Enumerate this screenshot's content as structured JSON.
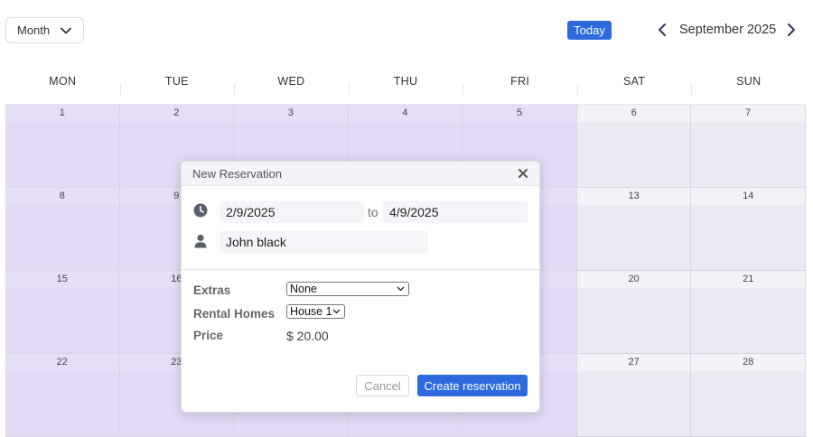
{
  "toolbar": {
    "view_label": "Month",
    "today_label": "Today",
    "month_label": "September 2025"
  },
  "calendar": {
    "days_of_week": [
      "MON",
      "TUE",
      "WED",
      "THU",
      "FRI",
      "SAT",
      "SUN"
    ],
    "weeks": [
      [
        "1",
        "2",
        "3",
        "4",
        "5",
        "6",
        "7"
      ],
      [
        "8",
        "9",
        "",
        "",
        "",
        "13",
        "14"
      ],
      [
        "15",
        "16",
        "",
        "",
        "",
        "20",
        "21"
      ],
      [
        "22",
        "23",
        "",
        "",
        "",
        "27",
        "28"
      ]
    ]
  },
  "modal": {
    "title": "New Reservation",
    "start_date": "2/9/2025",
    "to_label": "to",
    "end_date": "4/9/2025",
    "guest_name": "John black",
    "extras_label": "Extras",
    "extras_value": "None",
    "homes_label": "Rental Homes",
    "homes_value": "House 1",
    "price_label": "Price",
    "price_value": "$ 20.00",
    "cancel_label": "Cancel",
    "create_label": "Create reservation"
  },
  "colors": {
    "accent": "#2d6ae0",
    "selected_range": "#e3d9f5",
    "weekend": "#ece9f3"
  }
}
